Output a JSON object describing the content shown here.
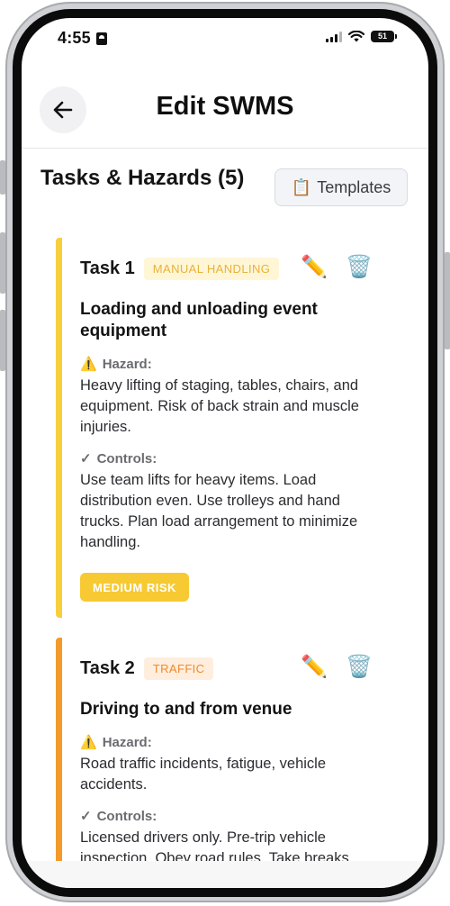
{
  "status_bar": {
    "time": "4:55",
    "battery": "51"
  },
  "header": {
    "title": "Edit SWMS",
    "back_icon": "arrow-left-icon"
  },
  "section": {
    "title": "Tasks & Hazards (5)",
    "templates_label": "Templates",
    "templates_icon": "clipboard-icon"
  },
  "colors": {
    "risk_medium": "#F7C932",
    "manual_accent": "#F7CF3D",
    "traffic_accent": "#F39A2B",
    "manual_badge_bg": "#FFF6D6",
    "manual_badge_text": "#E8B23A",
    "traffic_badge_bg": "#FFEEDD",
    "traffic_badge_text": "#EE8A2A"
  },
  "tasks": [
    {
      "name": "Task 1",
      "category": "MANUAL HANDLING",
      "title": "Loading and unloading event equipment",
      "hazard_label": "Hazard:",
      "hazard": "Heavy lifting of staging, tables, chairs, and equipment. Risk of back strain and muscle injuries.",
      "controls_label": "Controls:",
      "controls": "Use team lifts for heavy items. Load distribution even. Use trolleys and hand trucks. Plan load arrangement to minimize handling.",
      "risk": "MEDIUM RISK",
      "edit_icon": "pencil-icon",
      "delete_icon": "trash-icon"
    },
    {
      "name": "Task 2",
      "category": "TRAFFIC",
      "title": "Driving to and from venue",
      "hazard_label": "Hazard:",
      "hazard": "Road traffic incidents, fatigue, vehicle accidents.",
      "controls_label": "Controls:",
      "controls": "Licensed drivers only. Pre-trip vehicle inspection. Obey road rules. Take breaks",
      "edit_icon": "pencil-icon",
      "delete_icon": "trash-icon"
    }
  ]
}
